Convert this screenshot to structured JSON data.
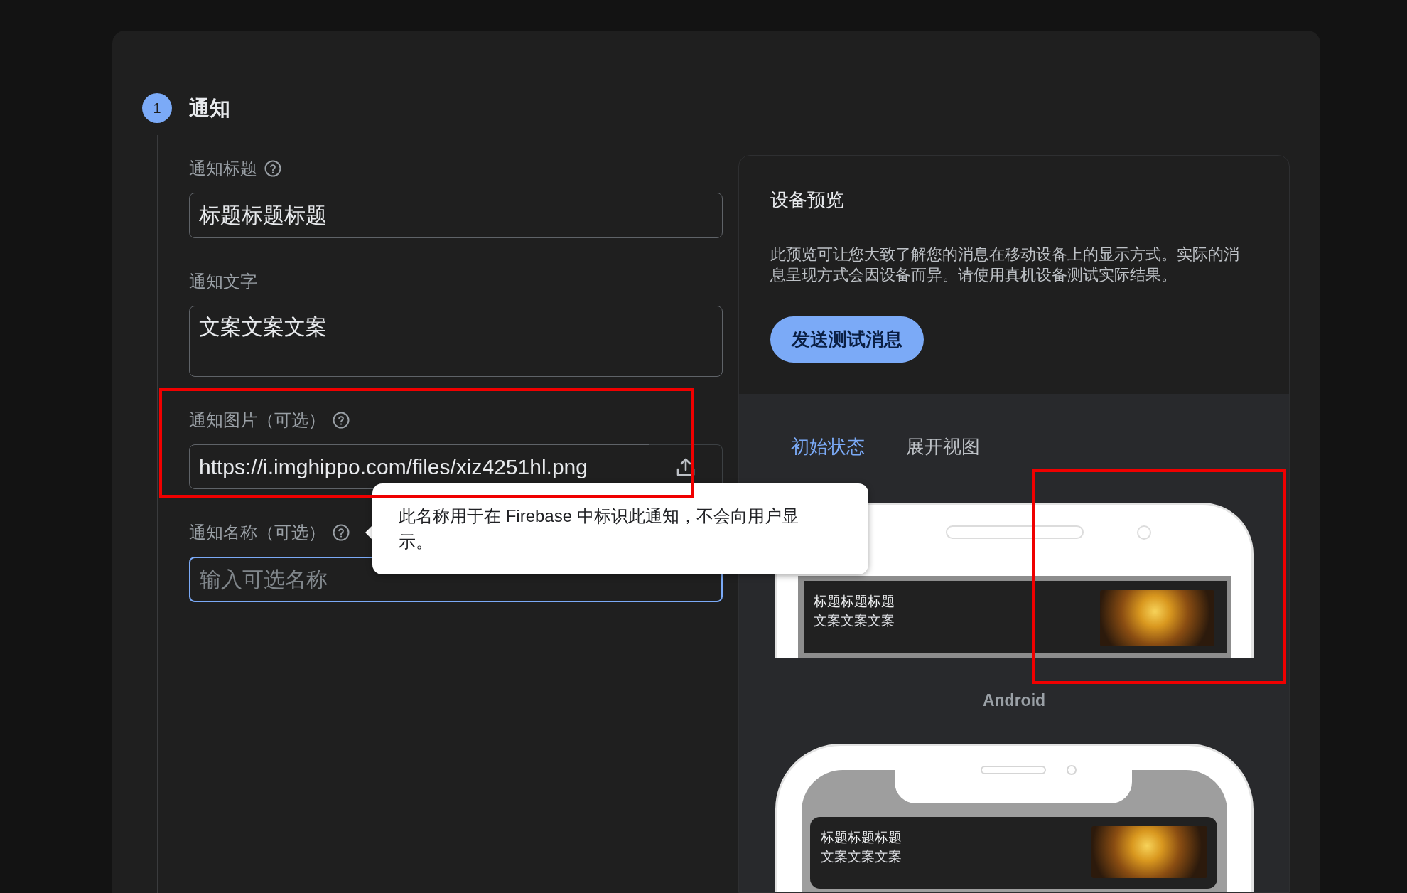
{
  "step": {
    "number": "1",
    "title": "通知"
  },
  "fields": [
    {
      "kind": "text",
      "label": "通知标题",
      "help": true,
      "value": "标题标题标题",
      "focused": false
    },
    {
      "kind": "textarea",
      "label": "通知文字",
      "help": false,
      "value": "文案文案文案",
      "focused": false
    },
    {
      "kind": "upload",
      "label": "通知图片（可选）",
      "help": true,
      "value": "https://i.imghippo.com/files/xiz4251hl.png",
      "focused": false
    },
    {
      "kind": "text",
      "label": "通知名称（可选）",
      "help": true,
      "placeholder": "输入可选名称",
      "focused": true,
      "tooltip": {
        "text": "此名称用于在 Firebase 中标识此通知，不会向用户显示。"
      }
    }
  ],
  "preview": {
    "title": "设备预览",
    "description": "此预览可让您大致了解您的消息在移动设备上的显示方式。实际的消息呈现方式会因设备而异。请使用真机设备测试实际结果。",
    "send_button": "发送测试消息",
    "tabs": [
      {
        "label": "初始状态",
        "selected": true
      },
      {
        "label": "展开视图",
        "selected": false
      }
    ],
    "devices": [
      {
        "kind": "android",
        "label": "Android",
        "notification": {
          "title": "标题标题标题",
          "body": "文案文案文案"
        }
      },
      {
        "kind": "iphone",
        "notification": {
          "title": "标题标题标题",
          "body": "文案文案文案"
        }
      }
    ]
  }
}
